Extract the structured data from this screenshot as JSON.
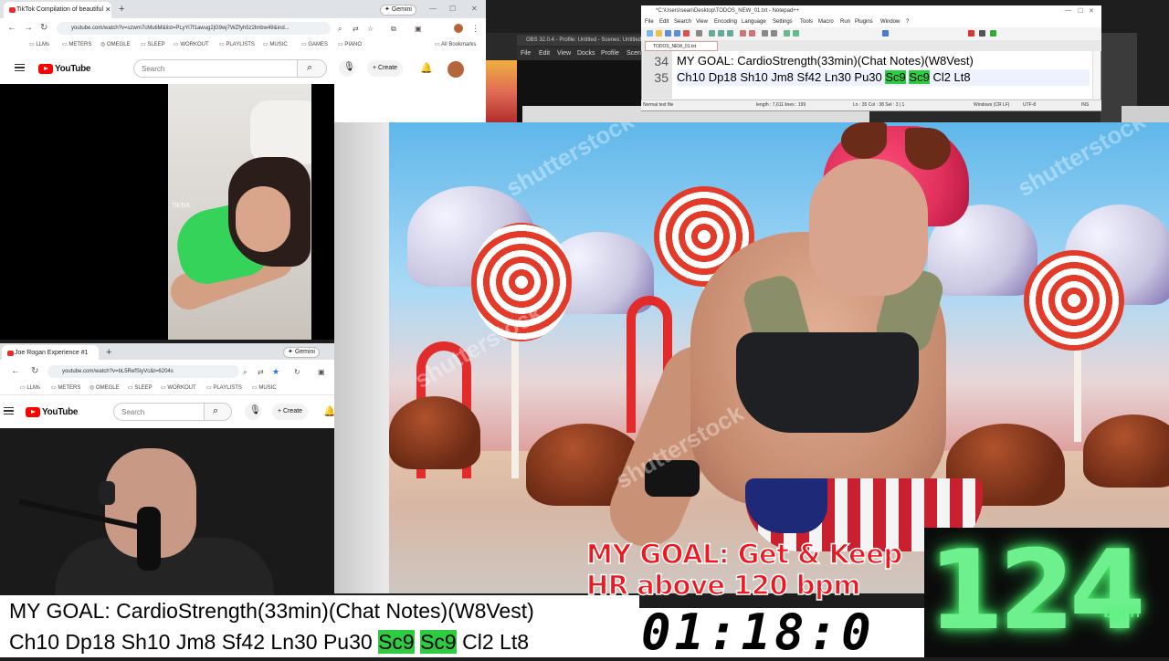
{
  "browser1": {
    "tab_title": "TikTok Compilation of beautiful",
    "gemini": "Gemini",
    "url": "youtube.com/watch?v=szwm7cMutiM&list=PLyYi7f1awug2jG9wj7WZfyh5z2lmbw49&ind...",
    "bookmarks": [
      "LLMs",
      "METERS",
      "OMEGLE",
      "SLEEP",
      "WORKOUT",
      "PLAYLISTS",
      "MUSIC",
      "GAMES",
      "PIANO"
    ],
    "all_bookmarks": "All Bookmarks",
    "search_placeholder": "Search",
    "create_label": "Create",
    "logo_text": "YouTube",
    "tiktok_label": "TikTok"
  },
  "browser2": {
    "tab_title": "Joe Rogan Experience #1",
    "gemini": "Gemini",
    "url": "youtube.com/watch?v=bL5RefSiyVc&t=6204s",
    "bookmarks": [
      "LLMs",
      "METERS",
      "OMEGLE",
      "SLEEP",
      "WORKOUT",
      "PLAYLISTS",
      "MUSIC"
    ],
    "search_placeholder": "Search",
    "create_label": "Create",
    "logo_text": "YouTube"
  },
  "obs": {
    "title": "OBS 32.0.4 - Profile: Untitled - Scenes: Untitled",
    "menu": [
      "File",
      "Edit",
      "View",
      "Docks",
      "Profile",
      "Scene C"
    ]
  },
  "notepad": {
    "title": "*C:\\Users\\sean\\Desktop\\TODOS_NEW_01.txt - Notepad++",
    "menu": [
      "File",
      "Edit",
      "Search",
      "View",
      "Encoding",
      "Language",
      "Settings",
      "Tools",
      "Macro",
      "Run",
      "Plugins",
      "Window",
      "?"
    ],
    "tab": "TODOS_NEW_01.txt",
    "lines": [
      {
        "num": "34",
        "text": "MY GOAL: CardioStrength(33min)(Chat Notes)(W8Vest)"
      },
      {
        "num": "35",
        "pre": "Ch10 Dp18 Sh10 Jm8 Sf42 Ln30 Pu30 ",
        "hl1": "Sc9",
        "hl2": "Sc9",
        "post": " Cl2 Lt8"
      }
    ],
    "status": {
      "type": "Normal text file",
      "length": "length : 7,611   lines : 199",
      "pos": "Ln : 35   Col : 38   Sel : 3 | 1",
      "eol": "Windows (CR LF)",
      "enc": "UTF-8",
      "mode": "INS"
    }
  },
  "overlay": {
    "goal_line1": "MY GOAL: Get & Keep",
    "goal_line2": "HR above 120 bpm",
    "heart_rate": "124",
    "heart_unit": "bpm",
    "timer": "01:18:0",
    "notes_line1": "MY GOAL: CardioStrength(33min)(Chat Notes)(W8Vest)",
    "notes_line2_pre": "Ch10 Dp18 Sh10 Jm8 Sf42 Ln30 Pu30 ",
    "notes_hl1": "Sc9",
    "notes_hl2": "Sc9",
    "notes_line2_post": " Cl2 Lt8",
    "watermark": "shutterstock"
  },
  "colors": {
    "highlight": "#2ecc40",
    "hr_green": "#6df08d",
    "goal_red": "#f2161f",
    "yt_red": "#ff0000"
  }
}
